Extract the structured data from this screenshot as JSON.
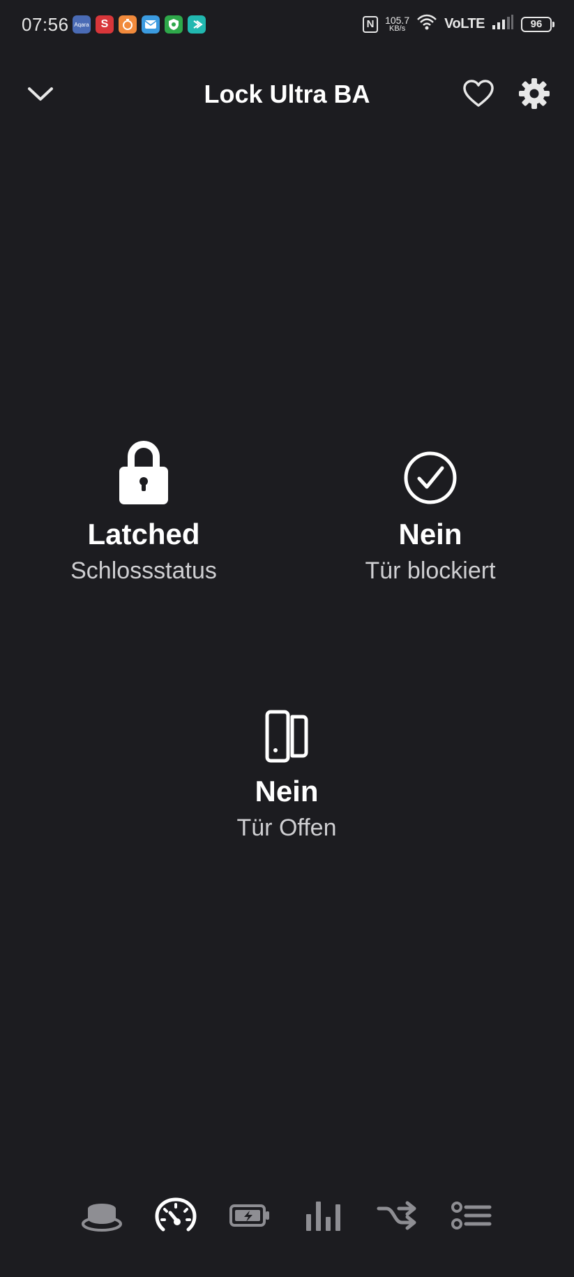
{
  "status_bar": {
    "time": "07:56",
    "notifications": [
      {
        "name": "aqara-icon",
        "label": "Aqara",
        "color": "#4a6bb5"
      },
      {
        "name": "s-app-icon",
        "label": "S",
        "color": "#d8363a"
      },
      {
        "name": "timer-app-icon",
        "label": "",
        "color": "#f18a3c"
      },
      {
        "name": "mail-app-icon",
        "label": "",
        "color": "#3b9be0"
      },
      {
        "name": "vpn-app-icon",
        "label": "",
        "color": "#2ea84a"
      },
      {
        "name": "teal-app-icon",
        "label": "",
        "color": "#21b8b0"
      }
    ],
    "nfc_label": "N",
    "net_speed_value": "105.7",
    "net_speed_unit": "KB/s",
    "network_type": "VoLTE",
    "battery": "96"
  },
  "header": {
    "title": "Lock Ultra BA"
  },
  "tiles": {
    "lock": {
      "value": "Latched",
      "label": "Schlossstatus",
      "icon": "lock-icon"
    },
    "blocked": {
      "value": "Nein",
      "label": "Tür blockiert",
      "icon": "check-circle-icon"
    },
    "door": {
      "value": "Nein",
      "label": "Tür Offen",
      "icon": "door-open-icon"
    }
  },
  "bottom_nav": [
    {
      "name": "nav-device-icon",
      "active": false
    },
    {
      "name": "nav-gauge-icon",
      "active": true
    },
    {
      "name": "nav-battery-icon",
      "active": false
    },
    {
      "name": "nav-stats-icon",
      "active": false
    },
    {
      "name": "nav-shuffle-icon",
      "active": false
    },
    {
      "name": "nav-list-icon",
      "active": false
    }
  ],
  "colors": {
    "background": "#1c1c20",
    "text_primary": "#ffffff",
    "text_secondary": "#cfcfd2",
    "icon_inactive": "#8e8e93"
  }
}
